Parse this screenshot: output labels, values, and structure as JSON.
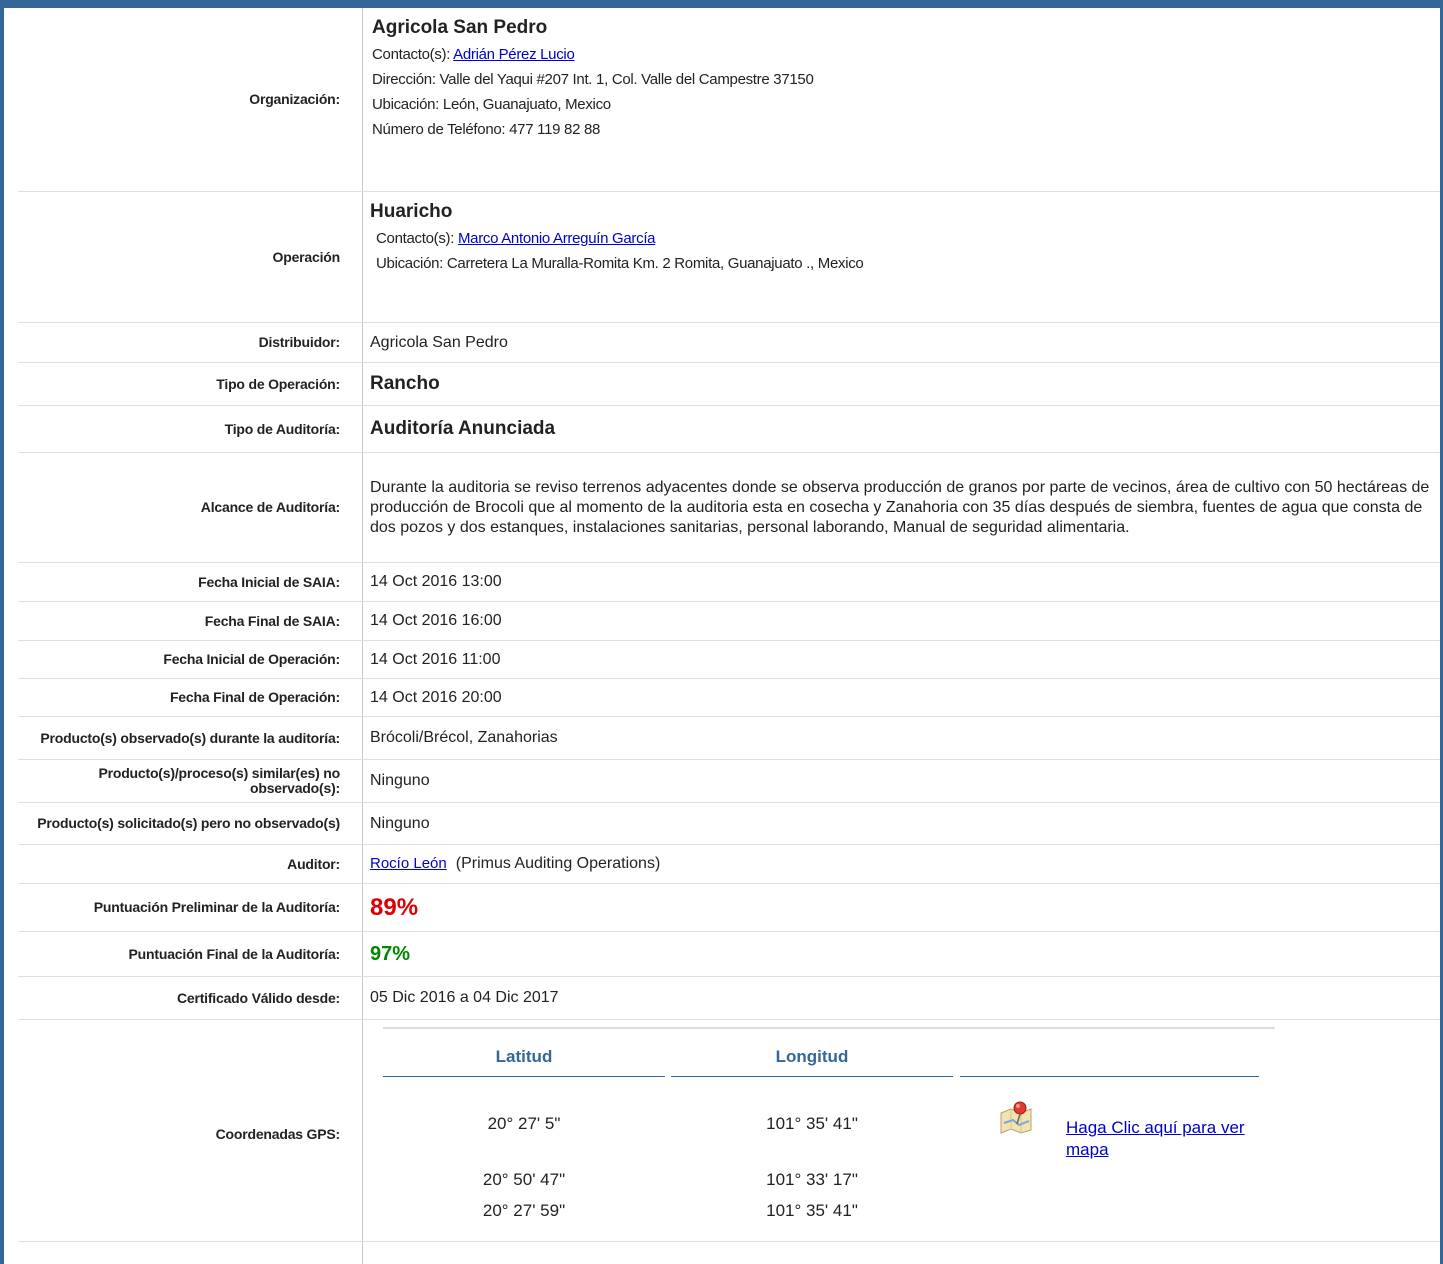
{
  "organization": {
    "label": "Organización:",
    "name": "Agricola San Pedro",
    "contact_prefix": "Contacto(s):",
    "contact_name": "Adrián Pérez Lucio",
    "address": "Dirección: Valle del Yaqui #207 Int. 1, Col. Valle del Campestre 37150",
    "location": "Ubicación: León, Guanajuato, Mexico",
    "phone": "Número de Teléfono: 477 119 82 88"
  },
  "operation": {
    "label": "Operación",
    "name": "Huaricho",
    "contact_prefix": "Contacto(s):",
    "contact_name": "Marco Antonio Arreguín García",
    "location": "Ubicación: Carretera La Muralla-Romita Km. 2 Romita, Guanajuato ., Mexico"
  },
  "distributor": {
    "label": "Distribuidor:",
    "value": "Agricola San Pedro"
  },
  "operation_type": {
    "label": "Tipo de Operación:",
    "value": "Rancho"
  },
  "audit_type": {
    "label": "Tipo de Auditoría:",
    "value": "Auditoría Anunciada"
  },
  "audit_scope": {
    "label": "Alcance de Auditoría:",
    "value": "Durante la auditoria se reviso terrenos adyacentes donde se observa producción de granos por parte de vecinos, área de cultivo con 50 hectáreas de producción de Brocoli que al momento de la auditoria esta en cosecha y Zanahoria con 35 días después de siembra, fuentes de agua que consta de dos pozos y dos estanques, instalaciones sanitarias, personal laborando, Manual de seguridad alimentaria."
  },
  "saia_start": {
    "label": "Fecha Inicial de SAIA:",
    "value": "14 Oct 2016 13:00"
  },
  "saia_end": {
    "label": "Fecha Final de SAIA:",
    "value": "14 Oct 2016 16:00"
  },
  "op_start": {
    "label": "Fecha Inicial de Operación:",
    "value": "14 Oct 2016 11:00"
  },
  "op_end": {
    "label": "Fecha Final de Operación:",
    "value": "14 Oct 2016 20:00"
  },
  "products_observed": {
    "label": "Producto(s) observado(s) durante la auditoría:",
    "value": "Brócoli/Brécol, Zanahorias"
  },
  "similar_not_observed": {
    "label": "Producto(s)/proceso(s) similar(es) no observado(s):",
    "value": "Ninguno"
  },
  "requested_not_observed": {
    "label": "Producto(s) solicitado(s) pero no observado(s)",
    "value": "Ninguno"
  },
  "auditor": {
    "label": "Auditor:",
    "name": "Rocío León",
    "company": "(Primus Auditing Operations)"
  },
  "prelim_score": {
    "label": "Puntuación Preliminar de la Auditoría:",
    "value": "89%"
  },
  "final_score": {
    "label": "Puntuación Final de la Auditoría:",
    "value": "97%"
  },
  "certificate": {
    "label": "Certificado Válido desde:",
    "value": "05 Dic 2016 a 04 Dic 2017"
  },
  "gps": {
    "label": "Coordenadas GPS:",
    "lat_header": "Latitud",
    "lon_header": "Longitud",
    "rows": [
      {
        "lat": "20° 27' 5\"",
        "lon": "101° 35' 41\""
      },
      {
        "lat": "20° 50' 47\"",
        "lon": "101° 33' 17\""
      },
      {
        "lat": "20° 27' 59\"",
        "lon": "101° 35' 41\""
      }
    ],
    "map_link": "Haga Clic aquí para ver mapa",
    "map_icon": "map-pin-icon"
  },
  "colors": {
    "frame": "#336699",
    "link": "#0000cc",
    "prelim_score": "#dd0000",
    "final_score": "#008800"
  }
}
